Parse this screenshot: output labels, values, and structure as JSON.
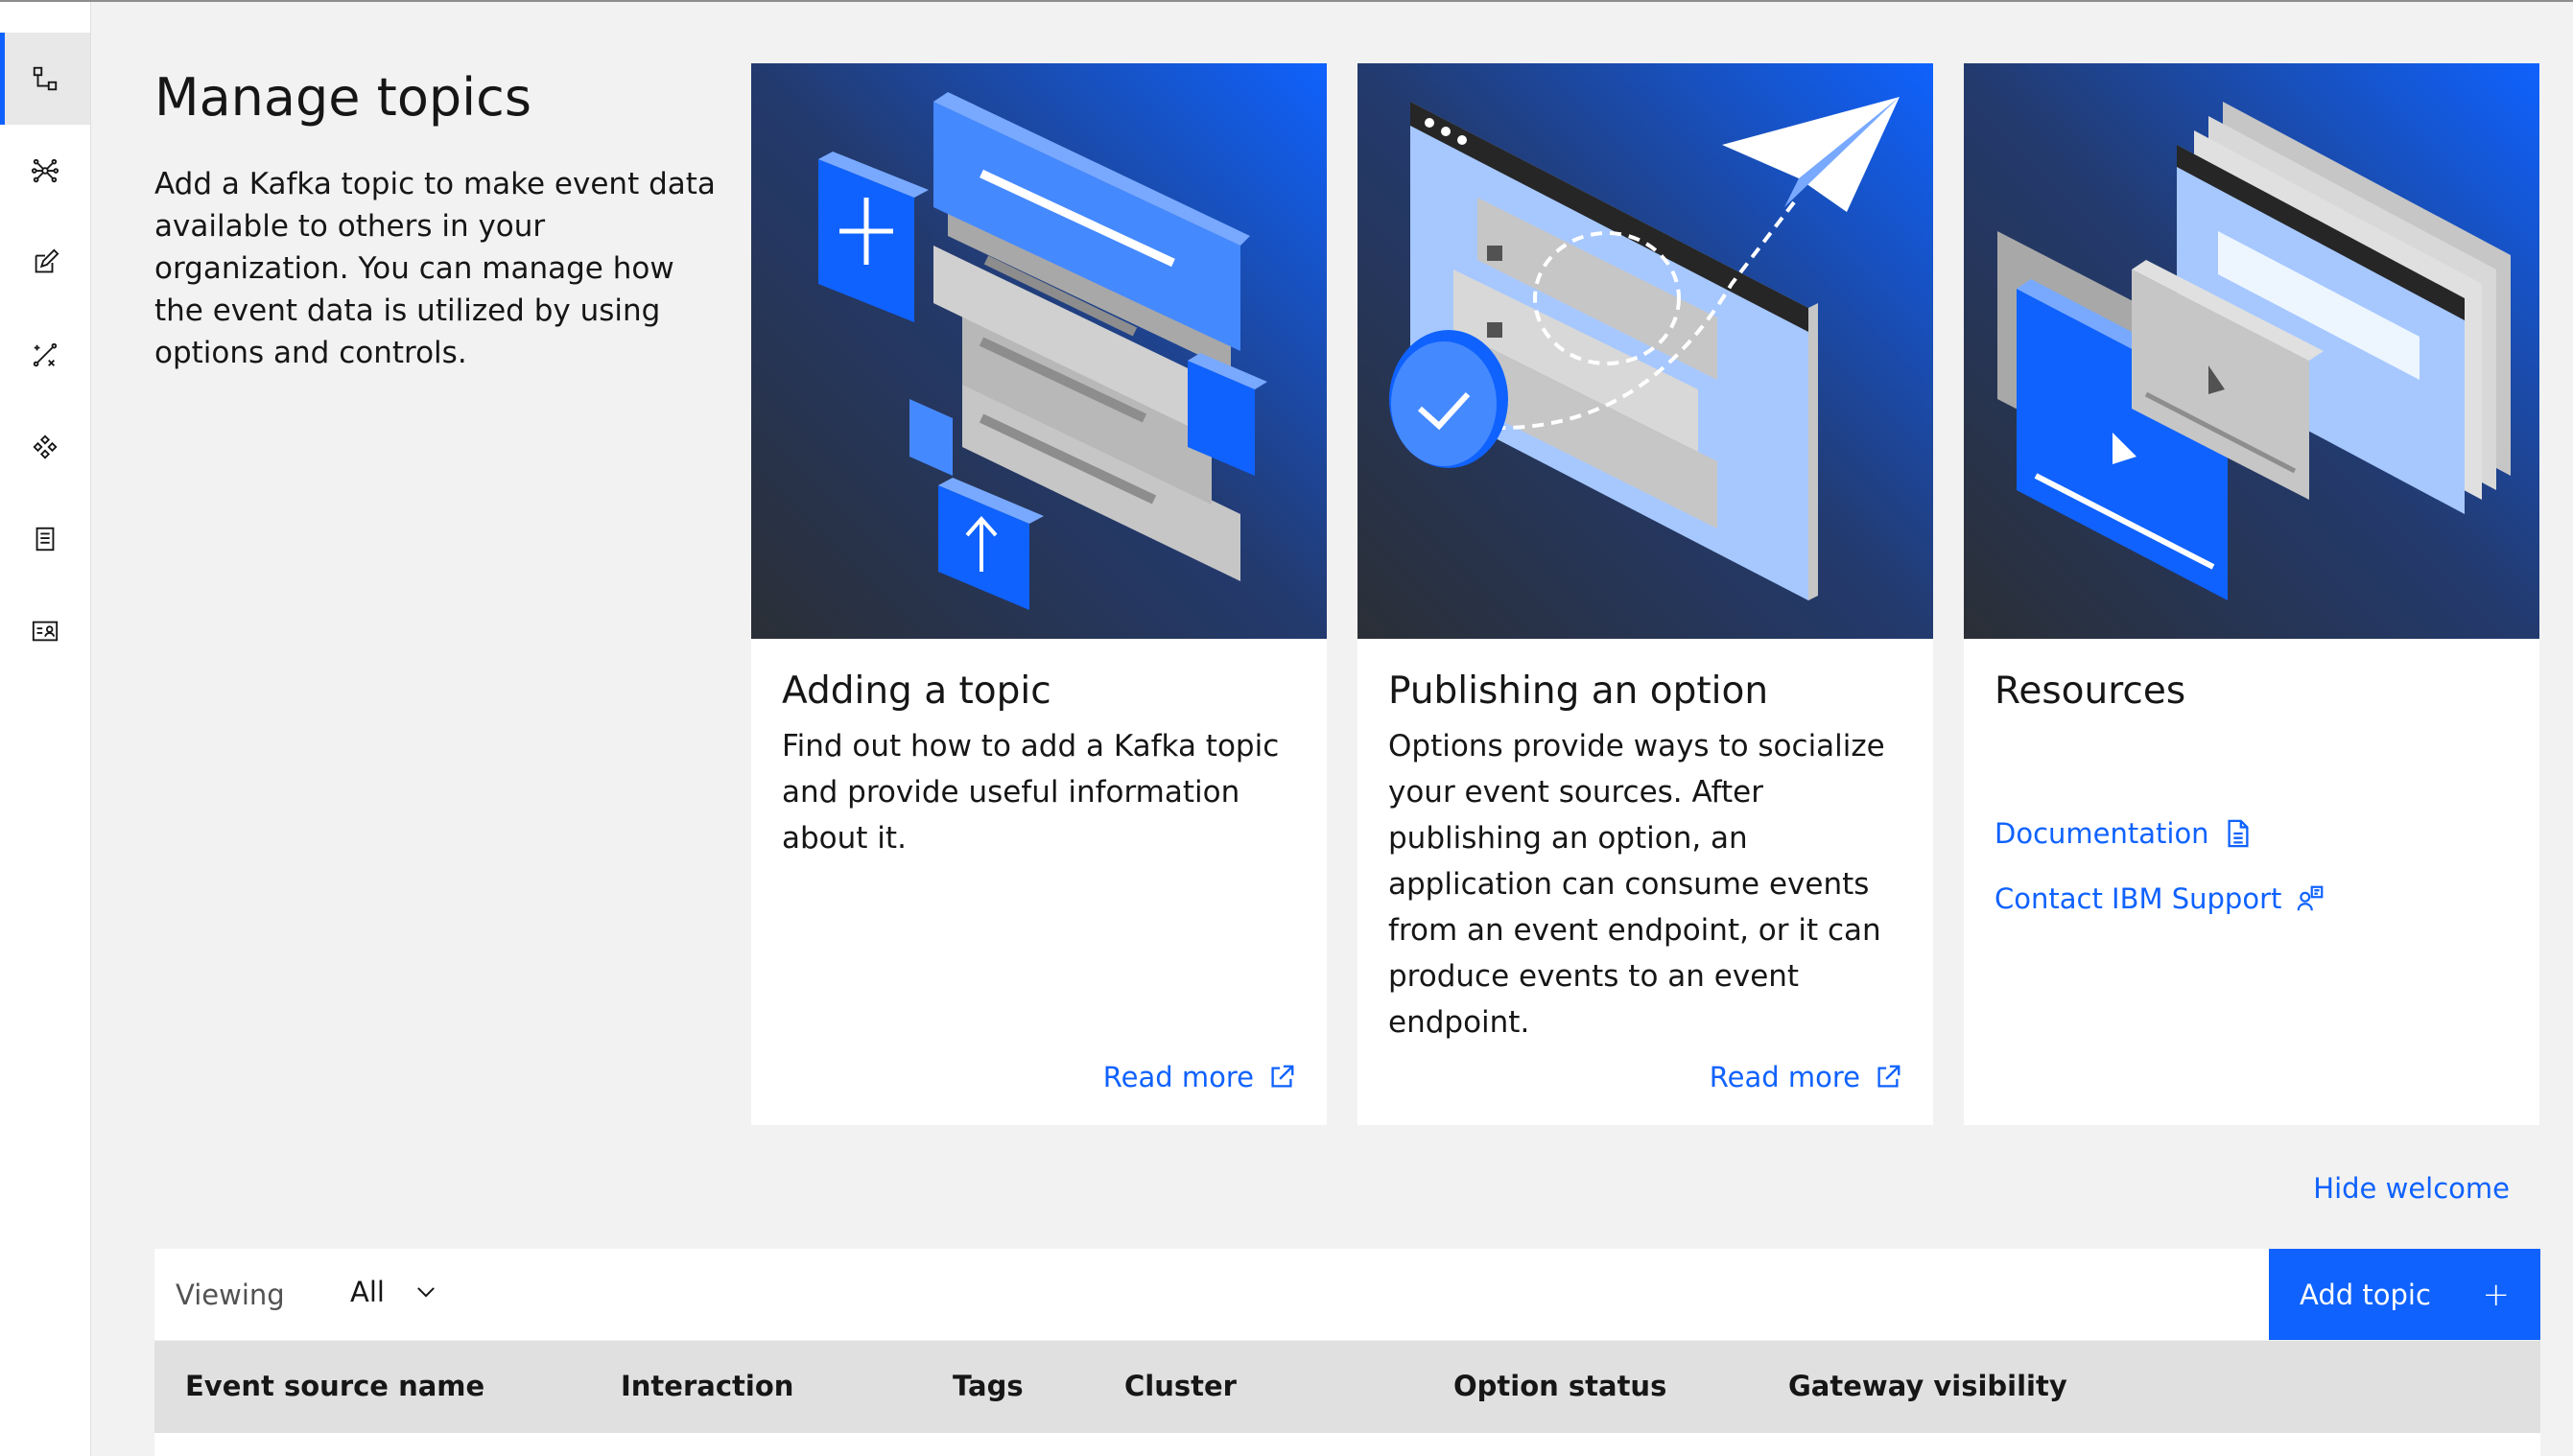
{
  "page": {
    "title": "Manage topics",
    "intro": "Add a Kafka topic to make event data available to others in your organization. You can manage how the event data is utilized by using options and controls."
  },
  "sidebar": {
    "items": [
      {
        "icon": "flow-icon",
        "active": true
      },
      {
        "icon": "network-icon",
        "active": false
      },
      {
        "icon": "edit-icon",
        "active": false
      },
      {
        "icon": "tools-icon",
        "active": false
      },
      {
        "icon": "integration-icon",
        "active": false
      },
      {
        "icon": "catalog-icon",
        "active": false
      },
      {
        "icon": "user-profile-icon",
        "active": false
      }
    ]
  },
  "cards": [
    {
      "title": "Adding a topic",
      "body": "Find out how to add a Kafka topic and provide useful information about it.",
      "link": "Read more"
    },
    {
      "title": "Publishing an option",
      "body": "Options provide ways to socialize your event sources. After publishing an option, an application can consume events from an event endpoint, or it can produce events to an event endpoint.",
      "link": "Read more"
    },
    {
      "title": "Resources",
      "links": [
        "Documentation",
        "Contact IBM Support"
      ]
    }
  ],
  "hide_welcome": "Hide welcome",
  "toolbar": {
    "viewing_label": "Viewing",
    "viewing_value": "All",
    "add_label": "Add topic",
    "add_icon": "+"
  },
  "table": {
    "headers": [
      "Event source name",
      "Interaction",
      "Tags",
      "Cluster",
      "Option status",
      "Gateway visibility"
    ]
  },
  "colors": {
    "accent": "#0f62fe",
    "art_dark": "#1f3c7a",
    "art_blue": "#0f62fe"
  }
}
